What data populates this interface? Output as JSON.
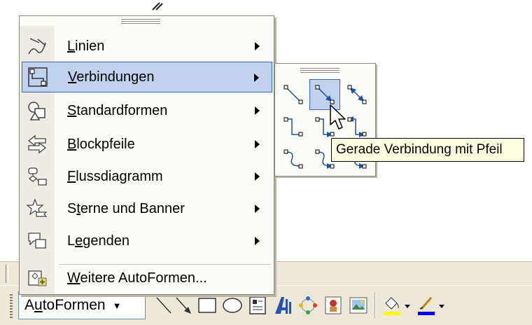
{
  "autoshapes_menu": {
    "items": [
      {
        "name": "linien",
        "pre": "",
        "ul": "L",
        "post": "inien",
        "has_submenu": true,
        "icon": "lines-icon"
      },
      {
        "name": "verbindungen",
        "pre": "",
        "ul": "V",
        "post": "erbindungen",
        "has_submenu": true,
        "icon": "connectors-icon",
        "active": true
      },
      {
        "name": "standardformen",
        "pre": "",
        "ul": "S",
        "post": "tandardformen",
        "has_submenu": true,
        "icon": "basic-shapes-icon"
      },
      {
        "name": "blockpfeile",
        "pre": "",
        "ul": "B",
        "post": "lockpfeile",
        "has_submenu": true,
        "icon": "block-arrows-icon"
      },
      {
        "name": "flussdiagramm",
        "pre": "",
        "ul": "F",
        "post": "lussdiagramm",
        "has_submenu": true,
        "icon": "flowchart-icon"
      },
      {
        "name": "sterne-und-banner",
        "pre": "S",
        "ul": "t",
        "post": "erne und Banner",
        "has_submenu": true,
        "icon": "stars-banners-icon"
      },
      {
        "name": "legenden",
        "pre": "L",
        "ul": "e",
        "post": "genden",
        "has_submenu": true,
        "icon": "callouts-icon"
      },
      {
        "name": "weitere-autoformen",
        "pre": "",
        "ul": "W",
        "post": "eitere AutoFormen...",
        "has_submenu": false,
        "icon": "more-autoshapes-icon"
      }
    ]
  },
  "connector_palette": {
    "selected_index": 1,
    "items": [
      "straight-connector-icon",
      "straight-arrow-connector-icon",
      "straight-double-arrow-connector-icon",
      "elbow-connector-icon",
      "elbow-arrow-connector-icon",
      "elbow-double-arrow-connector-icon",
      "curved-connector-icon",
      "curved-arrow-connector-icon",
      "curved-double-arrow-connector-icon"
    ]
  },
  "tooltip": {
    "text": "Gerade Verbindung mit Pfeil"
  },
  "toolbar": {
    "autoformen": {
      "pre": "A",
      "ul": "u",
      "post": "toFormen"
    },
    "tools": [
      "line-icon",
      "arrow-icon",
      "rectangle-icon",
      "oval-icon",
      "textbox-icon",
      "wordart-icon",
      "diagram-icon",
      "clipart-icon",
      "picture-icon",
      "fill-color-icon",
      "line-color-icon"
    ]
  },
  "colors": {
    "menu_highlight": "#c1d2ee",
    "menu_highlight_border": "#316ac5",
    "tooltip_bg": "#ffffe1",
    "toolbar_bg": "#ece9d8",
    "fill_color": "#ffff00",
    "line_color": "#0000ff"
  }
}
